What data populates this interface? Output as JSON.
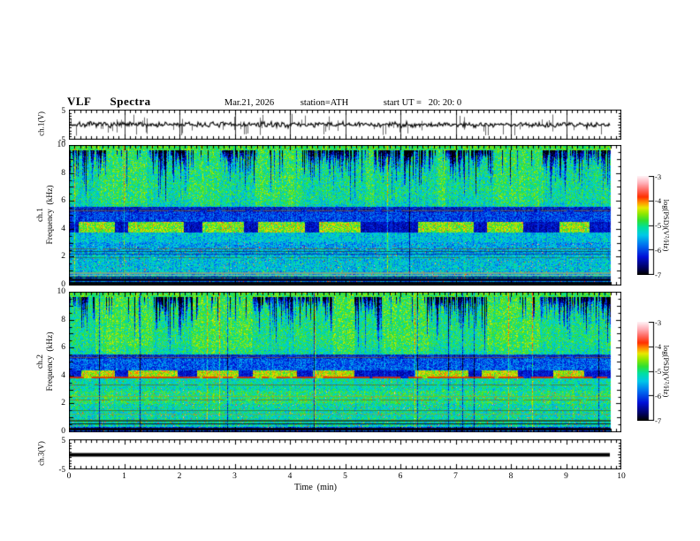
{
  "header": {
    "title": "VLF  Spectra",
    "date": "Mar.21, 2026",
    "station": "station=ATH",
    "start_ut": "start UT =   20: 20: 0"
  },
  "axes": {
    "time_label": "Time  (min)",
    "time_ticks": [
      0,
      1,
      2,
      3,
      4,
      5,
      6,
      7,
      8,
      9,
      10
    ],
    "time_range": [
      0,
      10
    ],
    "data_end_min": 9.79,
    "freq_ticks": [
      0,
      2,
      4,
      6,
      8,
      10
    ],
    "freq_range": [
      0,
      10
    ],
    "volt_ticks": [
      5,
      -5
    ],
    "volt_range": [
      -5,
      5
    ]
  },
  "panels": {
    "ch1_wave": {
      "label": "ch.1(V)"
    },
    "spec1": {
      "label_line1": "ch.1",
      "label_line2": "Frequency  (kHz)"
    },
    "spec2": {
      "label_line1": "ch.2",
      "label_line2": "Frequency  (kHz)"
    },
    "ch3_wave": {
      "label": "ch.3(V)"
    }
  },
  "colorbar": {
    "label": "log(PSD)(V²/Hz)",
    "ticks": [
      -3,
      -4,
      -5,
      -6,
      -7
    ],
    "range": [
      -7,
      -3
    ],
    "stops": [
      [
        0,
        "#000000"
      ],
      [
        0.07,
        "#000060"
      ],
      [
        0.18,
        "#0010d8"
      ],
      [
        0.3,
        "#0070f0"
      ],
      [
        0.4,
        "#00c8e8"
      ],
      [
        0.48,
        "#00e0a0"
      ],
      [
        0.55,
        "#30e030"
      ],
      [
        0.62,
        "#90e800"
      ],
      [
        0.68,
        "#e8e800"
      ],
      [
        0.73,
        "#ff9800"
      ],
      [
        0.79,
        "#ff3000"
      ],
      [
        0.86,
        "#ff6860"
      ],
      [
        0.93,
        "#ffb0b8"
      ],
      [
        1,
        "#fff0f4"
      ]
    ]
  },
  "chart_data": [
    {
      "type": "line",
      "name": "ch.1 voltage waveform",
      "ylabel": "ch.1(V)",
      "ylim": [
        -5,
        5
      ],
      "x_range_min": [
        0,
        9.79
      ],
      "description": "black noise trace ~±1 V about 0 V with sporadic narrow spikes to ±5 V; vertical grid line each minute",
      "seed": 7,
      "noise_amp": 1.0,
      "spike_count": 60,
      "spike_min_v": 1.0,
      "spike_max_v": 3.8,
      "color": "#000000",
      "grid_color": "#333333"
    },
    {
      "type": "heatmap",
      "name": "ch.1 VLF spectrogram",
      "ylabel": "ch.1 Frequency (kHz)",
      "freq_range_khz": [
        0,
        10
      ],
      "x_range_min": [
        0,
        9.79
      ],
      "value_range_logpsd": [
        -7,
        -3
      ],
      "seed": 11,
      "bands": [
        {
          "f": [
            9.68,
            10.01
          ],
          "base": 0.55,
          "noise": 0.1
        },
        {
          "f": [
            5.6,
            9.68
          ],
          "base": 0.52,
          "noise": 0.13,
          "streak": true
        },
        {
          "f": [
            5.25,
            5.6
          ],
          "base": 0.2,
          "noise": 0.1
        },
        {
          "f": [
            4.5,
            5.25
          ],
          "base": 0.24,
          "noise": 0.1
        },
        {
          "f": [
            3.75,
            4.5
          ],
          "base": 0.3,
          "noise": 0.1,
          "blob": true
        },
        {
          "f": [
            3.05,
            3.75
          ],
          "base": 0.4,
          "noise": 0.11
        },
        {
          "f": [
            2.1,
            3.05
          ],
          "base": 0.36,
          "noise": 0.12,
          "spice": 0.02
        },
        {
          "f": [
            0.95,
            2.1
          ],
          "base": 0.4,
          "noise": 0.12,
          "spice": 0.02
        },
        {
          "f": [
            0.5,
            0.95
          ],
          "base": 0.38,
          "noise": 0.14,
          "spice": 0.03
        },
        {
          "f": [
            0,
            0.5
          ],
          "base": 0.3,
          "noise": 0.1,
          "spice": 0.03
        }
      ],
      "blob_level": 0.6,
      "blob_noise": 0.12,
      "dark_level": 0.16,
      "events": [
        [
          0.15,
          0.8
        ],
        [
          1.05,
          2.05
        ],
        [
          2.4,
          3.15
        ],
        [
          3.4,
          4.25
        ],
        [
          4.5,
          5.25
        ],
        [
          6.3,
          7.3
        ],
        [
          7.55,
          8.2
        ],
        [
          8.85,
          9.4
        ]
      ],
      "streak_clusters": [
        [
          0,
          0.55
        ],
        [
          1.4,
          2.15
        ],
        [
          2.7,
          3.35
        ],
        [
          4.2,
          5.35
        ],
        [
          5.5,
          6.65
        ],
        [
          6.8,
          7.65
        ],
        [
          8.55,
          9.79
        ]
      ],
      "hlines": [
        {
          "f": 5.32,
          "color": "#7a5820",
          "alpha": 0.8,
          "dash": true,
          "w": 1
        },
        {
          "f": 5.47,
          "color": "#282828",
          "alpha": 0.5,
          "dash": true,
          "w": 1
        },
        {
          "f": 2.62,
          "color": "#6a5a20",
          "alpha": 0.7,
          "dash": true,
          "w": 1
        },
        {
          "f": 2.42,
          "color": "#14380f",
          "alpha": 0.6,
          "dash": false,
          "w": 1
        },
        {
          "f": 2.25,
          "color": "#001060",
          "alpha": 0.5,
          "dash": false,
          "w": 1
        },
        {
          "f": 1.95,
          "color": "#405818",
          "alpha": 0.5,
          "dash": true,
          "w": 1
        },
        {
          "f": 0.88,
          "color": "#90a878",
          "alpha": 0.8,
          "dash": false,
          "w": 2
        },
        {
          "f": 0.72,
          "color": "#a8b890",
          "alpha": 0.7,
          "dash": false,
          "w": 1
        },
        {
          "f": 0.56,
          "color": "#000000",
          "alpha": 0.85,
          "dash": false,
          "w": 1
        },
        {
          "f": 0.44,
          "color": "#000008",
          "alpha": 0.9,
          "dash": false,
          "w": 2
        },
        {
          "f": 0.3,
          "color": "#000020",
          "alpha": 0.9,
          "dash": false,
          "w": 1
        },
        {
          "f": 0.18,
          "color": "#000000",
          "alpha": 0.95,
          "dash": false,
          "w": 2
        },
        {
          "f": 0.07,
          "color": "#000000",
          "alpha": 0.95,
          "dash": false,
          "w": 1
        }
      ]
    },
    {
      "type": "heatmap",
      "name": "ch.2 VLF spectrogram",
      "ylabel": "ch.2 Frequency (kHz)",
      "freq_range_khz": [
        0,
        10
      ],
      "x_range_min": [
        0,
        9.79
      ],
      "value_range_logpsd": [
        -7,
        -3
      ],
      "seed": 23,
      "bands": [
        {
          "f": [
            9.68,
            10.01
          ],
          "base": 0.55,
          "noise": 0.1
        },
        {
          "f": [
            5.55,
            9.68
          ],
          "base": 0.54,
          "noise": 0.12,
          "streak": true
        },
        {
          "f": [
            5.2,
            5.55
          ],
          "base": 0.22,
          "noise": 0.1
        },
        {
          "f": [
            4.4,
            5.2
          ],
          "base": 0.27,
          "noise": 0.11
        },
        {
          "f": [
            3.85,
            4.4
          ],
          "base": 0.34,
          "noise": 0.1,
          "blob": true
        },
        {
          "f": [
            2.9,
            3.85
          ],
          "base": 0.46,
          "noise": 0.11,
          "spice": 0.015
        },
        {
          "f": [
            2.0,
            2.9
          ],
          "base": 0.5,
          "noise": 0.12,
          "spice": 0.02
        },
        {
          "f": [
            0.85,
            2.0
          ],
          "base": 0.46,
          "noise": 0.12,
          "spice": 0.025
        },
        {
          "f": [
            0.35,
            0.85
          ],
          "base": 0.44,
          "noise": 0.13,
          "spice": 0.03
        },
        {
          "f": [
            0,
            0.35
          ],
          "base": 0.25,
          "noise": 0.1,
          "spice": 0.02
        }
      ],
      "blob_level": 0.64,
      "blob_noise": 0.11,
      "dark_level": 0.18,
      "events": [
        [
          0.2,
          0.8
        ],
        [
          1.05,
          1.95
        ],
        [
          2.3,
          3.05
        ],
        [
          3.3,
          4.1
        ],
        [
          4.4,
          5.15
        ],
        [
          6.25,
          7.2
        ],
        [
          7.45,
          8.1
        ],
        [
          8.75,
          9.3
        ]
      ],
      "streak_clusters": [
        [
          0,
          0.45
        ],
        [
          1.5,
          2.2
        ],
        [
          3.3,
          4.75
        ],
        [
          5.15,
          5.65
        ],
        [
          6.5,
          7.55
        ],
        [
          8.5,
          9.79
        ]
      ],
      "hlines": [
        {
          "f": 5.32,
          "color": "#7a5820",
          "alpha": 0.8,
          "dash": true,
          "w": 1
        },
        {
          "f": 5.45,
          "color": "#282828",
          "alpha": 0.5,
          "dash": true,
          "w": 1
        },
        {
          "f": 3.92,
          "color": "#e03000",
          "alpha": 0.85,
          "dash": true,
          "w": 2
        },
        {
          "f": 3.35,
          "color": "#6a5a20",
          "alpha": 0.7,
          "dash": true,
          "w": 1
        },
        {
          "f": 2.55,
          "color": "#98a030",
          "alpha": 0.7,
          "dash": false,
          "w": 1
        },
        {
          "f": 2.32,
          "color": "#7a6820",
          "alpha": 0.7,
          "dash": true,
          "w": 1
        },
        {
          "f": 1.5,
          "color": "#405818",
          "alpha": 0.6,
          "dash": false,
          "w": 1
        },
        {
          "f": 1.3,
          "color": "#98a030",
          "alpha": 0.6,
          "dash": true,
          "w": 1
        },
        {
          "f": 0.85,
          "color": "#203808",
          "alpha": 0.7,
          "dash": false,
          "w": 2
        },
        {
          "f": 0.6,
          "color": "#000000",
          "alpha": 0.85,
          "dash": false,
          "w": 1
        },
        {
          "f": 0.28,
          "color": "#000000",
          "alpha": 0.9,
          "dash": false,
          "w": 2
        },
        {
          "f": 0.12,
          "color": "#000000",
          "alpha": 0.95,
          "dash": false,
          "w": 1
        }
      ]
    },
    {
      "type": "line",
      "name": "ch.3 voltage waveform",
      "ylabel": "ch.3(V)",
      "ylim": [
        -5,
        5
      ],
      "x_range_min": [
        0,
        9.79
      ],
      "description": "constant thick black line at 0 V",
      "constant_v": 0,
      "line_width": 4,
      "color": "#000000"
    }
  ]
}
